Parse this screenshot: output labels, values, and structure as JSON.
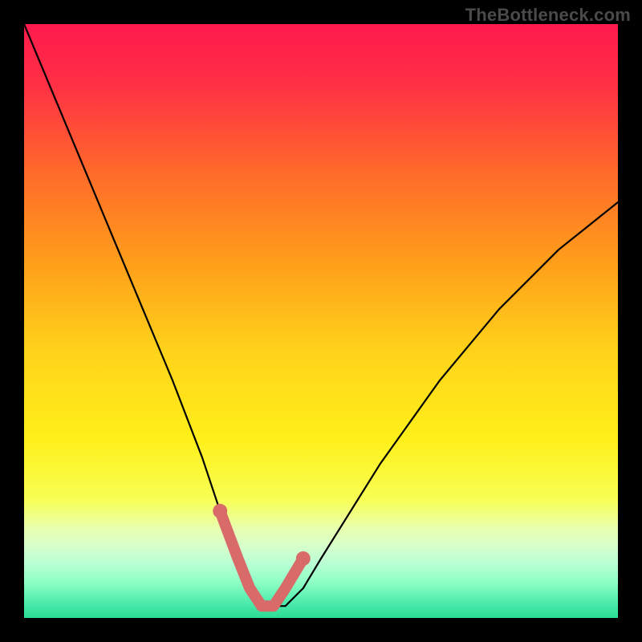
{
  "watermark": "TheBottleneck.com",
  "colors": {
    "background": "#000000",
    "curve_main": "#000000",
    "curve_accent": "#d86a6a",
    "watermark_text": "#4a4a4a",
    "gradient_stops": [
      {
        "offset": 0.0,
        "color": "#ff1a4d"
      },
      {
        "offset": 0.1,
        "color": "#ff2f45"
      },
      {
        "offset": 0.25,
        "color": "#ff6a2a"
      },
      {
        "offset": 0.4,
        "color": "#ff9e1a"
      },
      {
        "offset": 0.55,
        "color": "#ffd21a"
      },
      {
        "offset": 0.7,
        "color": "#fff01a"
      },
      {
        "offset": 0.8,
        "color": "#f8ff55"
      },
      {
        "offset": 0.85,
        "color": "#e8ffb0"
      },
      {
        "offset": 0.88,
        "color": "#d6ffcc"
      },
      {
        "offset": 0.91,
        "color": "#b8ffd4"
      },
      {
        "offset": 0.94,
        "color": "#8effc4"
      },
      {
        "offset": 0.97,
        "color": "#55eeb0"
      },
      {
        "offset": 1.0,
        "color": "#2adc95"
      }
    ]
  },
  "chart_data": {
    "type": "line",
    "title": "",
    "xlabel": "",
    "ylabel": "",
    "xlim": [
      0,
      100
    ],
    "ylim": [
      0,
      100
    ],
    "grid": false,
    "legend": false,
    "series": [
      {
        "name": "bottleneck-curve",
        "x": [
          0,
          5,
          10,
          15,
          20,
          25,
          30,
          33,
          36,
          38,
          40,
          42,
          44,
          47,
          50,
          55,
          60,
          65,
          70,
          75,
          80,
          85,
          90,
          95,
          100
        ],
        "y": [
          100,
          88,
          76,
          64,
          52,
          40,
          27,
          18,
          10,
          5,
          2,
          2,
          2,
          5,
          10,
          18,
          26,
          33,
          40,
          46,
          52,
          57,
          62,
          66,
          70
        ]
      },
      {
        "name": "accent-bottom",
        "x": [
          33,
          36,
          38,
          40,
          42,
          44,
          47
        ],
        "y": [
          18,
          10,
          5,
          2,
          2,
          5,
          10
        ]
      }
    ],
    "annotations": []
  }
}
